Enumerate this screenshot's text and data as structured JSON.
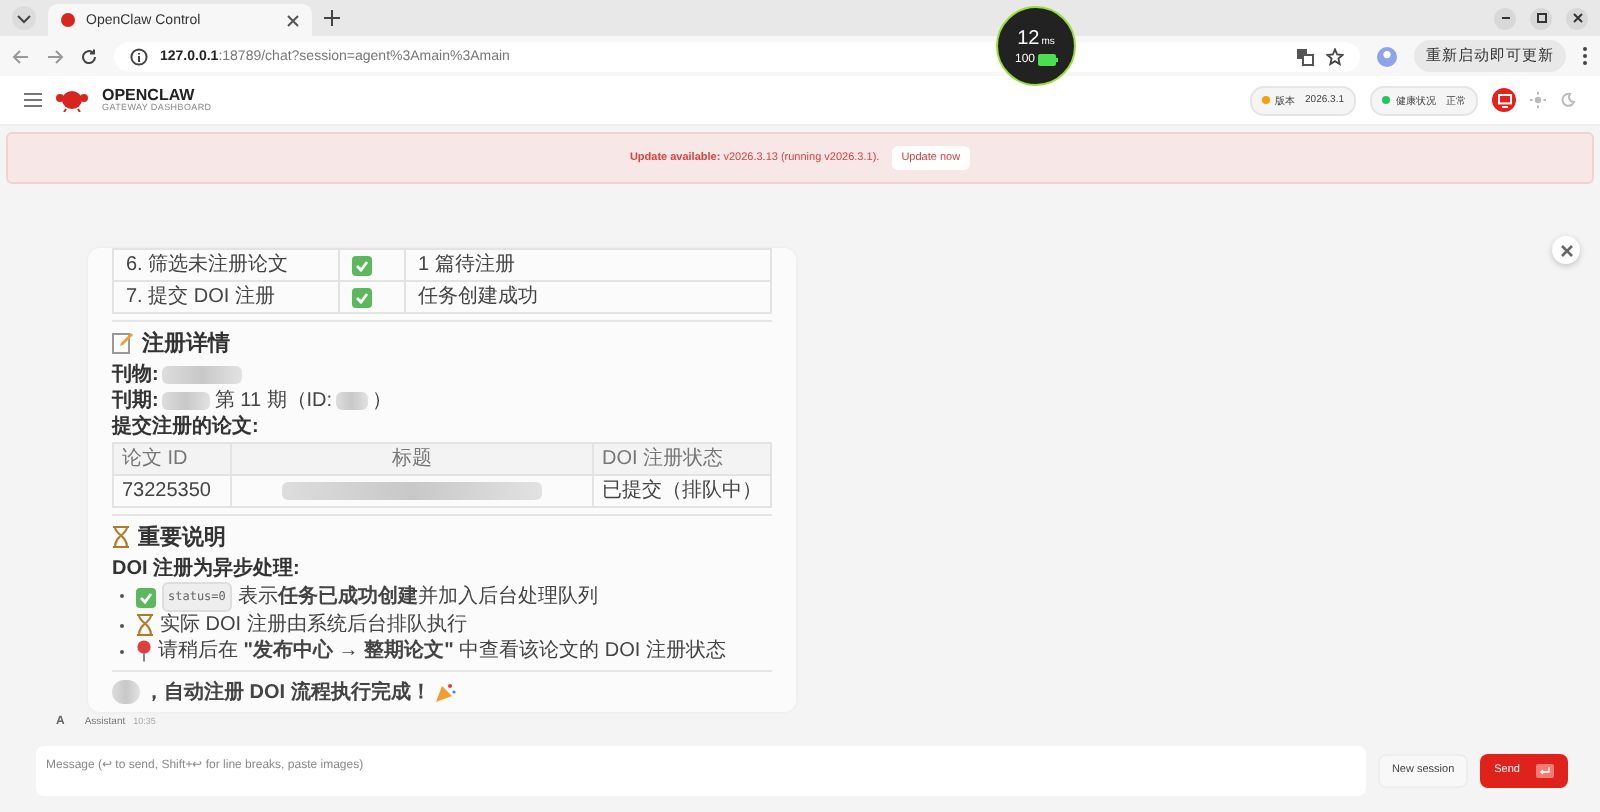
{
  "browser": {
    "tab_title": "OpenClaw Control",
    "url_host": "127.0.0.1",
    "url_rest": ":18789/chat?session=agent%3Amain%3Amain",
    "update_button": "重新启动即可更新"
  },
  "perf_overlay": {
    "latency": "12",
    "unit": "ms",
    "battery": "100"
  },
  "header": {
    "brand": "OPENCLAW",
    "subtitle": "GATEWAY DASHBOARD",
    "pills": [
      {
        "label": "版本",
        "value": "2026.3.1",
        "color": "#f59e0b"
      },
      {
        "label": "健康状况",
        "value": "正常",
        "color": "#22c55e"
      }
    ]
  },
  "banner": {
    "lead": "Update available:",
    "text": "v2026.3.13 (running v2026.3.1).",
    "button": "Update now"
  },
  "message": {
    "steps": [
      {
        "step": "6. 筛选未注册论文",
        "result": "1 篇待注册"
      },
      {
        "step": "7. 提交 DOI 注册",
        "result": "任务创建成功"
      }
    ],
    "details_heading": "注册详情",
    "journal_label": "刊物:",
    "issue_label": "刊期:",
    "issue_text": "第 11 期（ID:",
    "issue_end": "）",
    "papers_label": "提交注册的论文:",
    "paper_columns": [
      "论文 ID",
      "标题",
      "DOI 注册状态"
    ],
    "paper_rows": [
      {
        "id": "73225350",
        "status": "已提交（排队中）"
      }
    ],
    "notes_heading": "重要说明",
    "notes_lead": "DOI 注册为异步处理:",
    "notes": [
      {
        "kind": "check",
        "code": "status=0",
        "text": "表示**任务已成功创建**并加入后台处理队列"
      },
      {
        "kind": "hourglass",
        "text": "实际 DOI 注册由系统后台排队执行"
      },
      {
        "kind": "pin",
        "text": "请稍后在 **\"发布中心 → 整期论文\"** 中查看该论文的 DOI 注册状态"
      }
    ],
    "closing": "，自动注册 DOI 流程执行完成！",
    "avatar": "A",
    "sender": "Assistant",
    "time": "10:35"
  },
  "composer": {
    "placeholder": "Message (↩ to send, Shift+↩ for line breaks, paste images)",
    "new_session": "New session",
    "send": "Send"
  }
}
